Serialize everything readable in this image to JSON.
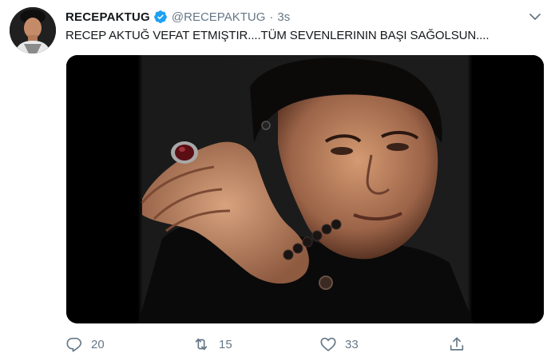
{
  "tweet": {
    "display_name": "RECEPAKTUG",
    "verified": true,
    "handle": "@RECEPAKTUG",
    "separator": "·",
    "time": "3s",
    "text": "RECEP AKTUĞ VEFAT ETMIŞTIR....TÜM SEVENLERININ BAŞI SAĞOLSUN....",
    "media": {
      "type": "photo"
    },
    "actions": {
      "reply": {
        "icon": "reply-icon",
        "count": "20"
      },
      "retweet": {
        "icon": "retweet-icon",
        "count": "15"
      },
      "like": {
        "icon": "heart-icon",
        "count": "33"
      },
      "share": {
        "icon": "share-icon"
      }
    }
  },
  "colors": {
    "text": "#14171a",
    "secondary": "#657786",
    "verified": "#1da1f2",
    "background": "#ffffff"
  }
}
